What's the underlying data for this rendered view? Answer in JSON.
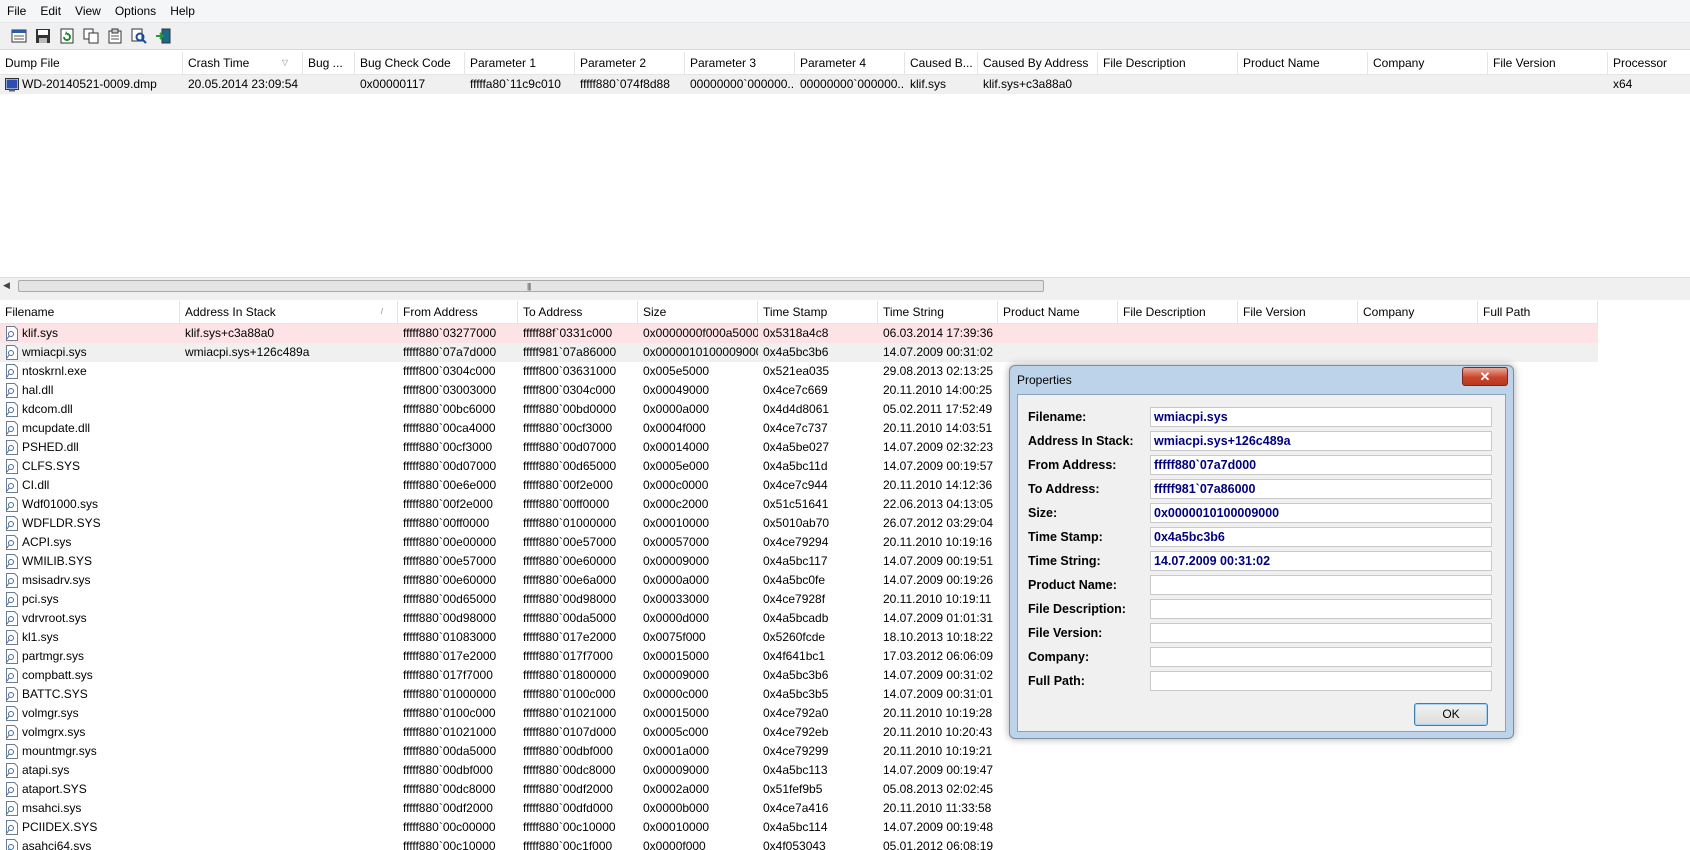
{
  "menu": [
    "File",
    "Edit",
    "View",
    "Options",
    "Help"
  ],
  "toolbar": [
    "properties-icon",
    "save-icon",
    "refresh-icon",
    "copy-icon",
    "report-icon",
    "find-icon",
    "exit-icon"
  ],
  "top_table": {
    "columns": [
      "Dump File",
      "Crash Time",
      "Bug ...",
      "Bug Check Code",
      "Parameter 1",
      "Parameter 2",
      "Parameter 3",
      "Parameter 4",
      "Caused B...",
      "Caused By Address",
      "File Description",
      "Product Name",
      "Company",
      "File Version",
      "Processor"
    ],
    "rows": [
      [
        "WD-20140521-0009.dmp",
        "20.05.2014 23:09:54",
        "",
        "0x00000117",
        "fffffa80`11c9c010",
        "fffff880`074f8d88",
        "00000000`000000...",
        "00000000`000000...",
        "klif.sys",
        "klif.sys+c3a88a0",
        "",
        "",
        "",
        "",
        "x64"
      ]
    ]
  },
  "bottom_table": {
    "columns": [
      "Filename",
      "Address In Stack",
      "From Address",
      "To Address",
      "Size",
      "Time Stamp",
      "Time String",
      "Product Name",
      "File Description",
      "File Version",
      "Company",
      "Full Path"
    ],
    "rows": [
      [
        "klif.sys",
        "klif.sys+c3a88a0",
        "fffff880`03277000",
        "fffff88f`0331c000",
        "0x0000000f000a5000",
        "0x5318a4c8",
        "06.03.2014 17:39:36"
      ],
      [
        "wmiacpi.sys",
        "wmiacpi.sys+126c489a",
        "fffff880`07a7d000",
        "fffff981`07a86000",
        "0x0000010100009000",
        "0x4a5bc3b6",
        "14.07.2009 00:31:02"
      ],
      [
        "ntoskrnl.exe",
        "",
        "fffff800`0304c000",
        "fffff800`03631000",
        "0x005e5000",
        "0x521ea035",
        "29.08.2013 02:13:25"
      ],
      [
        "hal.dll",
        "",
        "fffff800`03003000",
        "fffff800`0304c000",
        "0x00049000",
        "0x4ce7c669",
        "20.11.2010 14:00:25"
      ],
      [
        "kdcom.dll",
        "",
        "fffff880`00bc6000",
        "fffff880`00bd0000",
        "0x0000a000",
        "0x4d4d8061",
        "05.02.2011 17:52:49"
      ],
      [
        "mcupdate.dll",
        "",
        "fffff880`00ca4000",
        "fffff880`00cf3000",
        "0x0004f000",
        "0x4ce7c737",
        "20.11.2010 14:03:51"
      ],
      [
        "PSHED.dll",
        "",
        "fffff880`00cf3000",
        "fffff880`00d07000",
        "0x00014000",
        "0x4a5be027",
        "14.07.2009 02:32:23"
      ],
      [
        "CLFS.SYS",
        "",
        "fffff880`00d07000",
        "fffff880`00d65000",
        "0x0005e000",
        "0x4a5bc11d",
        "14.07.2009 00:19:57"
      ],
      [
        "CI.dll",
        "",
        "fffff880`00e6e000",
        "fffff880`00f2e000",
        "0x000c0000",
        "0x4ce7c944",
        "20.11.2010 14:12:36"
      ],
      [
        "Wdf01000.sys",
        "",
        "fffff880`00f2e000",
        "fffff880`00ff0000",
        "0x000c2000",
        "0x51c51641",
        "22.06.2013 04:13:05"
      ],
      [
        "WDFLDR.SYS",
        "",
        "fffff880`00ff0000",
        "fffff880`01000000",
        "0x00010000",
        "0x5010ab70",
        "26.07.2012 03:29:04"
      ],
      [
        "ACPI.sys",
        "",
        "fffff880`00e00000",
        "fffff880`00e57000",
        "0x00057000",
        "0x4ce79294",
        "20.11.2010 10:19:16"
      ],
      [
        "WMILIB.SYS",
        "",
        "fffff880`00e57000",
        "fffff880`00e60000",
        "0x00009000",
        "0x4a5bc117",
        "14.07.2009 00:19:51"
      ],
      [
        "msisadrv.sys",
        "",
        "fffff880`00e60000",
        "fffff880`00e6a000",
        "0x0000a000",
        "0x4a5bc0fe",
        "14.07.2009 00:19:26"
      ],
      [
        "pci.sys",
        "",
        "fffff880`00d65000",
        "fffff880`00d98000",
        "0x00033000",
        "0x4ce7928f",
        "20.11.2010 10:19:11"
      ],
      [
        "vdrvroot.sys",
        "",
        "fffff880`00d98000",
        "fffff880`00da5000",
        "0x0000d000",
        "0x4a5bcadb",
        "14.07.2009 01:01:31"
      ],
      [
        "kl1.sys",
        "",
        "fffff880`01083000",
        "fffff880`017e2000",
        "0x0075f000",
        "0x5260fcde",
        "18.10.2013 10:18:22"
      ],
      [
        "partmgr.sys",
        "",
        "fffff880`017e2000",
        "fffff880`017f7000",
        "0x00015000",
        "0x4f641bc1",
        "17.03.2012 06:06:09"
      ],
      [
        "compbatt.sys",
        "",
        "fffff880`017f7000",
        "fffff880`01800000",
        "0x00009000",
        "0x4a5bc3b6",
        "14.07.2009 00:31:02"
      ],
      [
        "BATTC.SYS",
        "",
        "fffff880`01000000",
        "fffff880`0100c000",
        "0x0000c000",
        "0x4a5bc3b5",
        "14.07.2009 00:31:01"
      ],
      [
        "volmgr.sys",
        "",
        "fffff880`0100c000",
        "fffff880`01021000",
        "0x00015000",
        "0x4ce792a0",
        "20.11.2010 10:19:28"
      ],
      [
        "volmgrx.sys",
        "",
        "fffff880`01021000",
        "fffff880`0107d000",
        "0x0005c000",
        "0x4ce792eb",
        "20.11.2010 10:20:43"
      ],
      [
        "mountmgr.sys",
        "",
        "fffff880`00da5000",
        "fffff880`00dbf000",
        "0x0001a000",
        "0x4ce79299",
        "20.11.2010 10:19:21"
      ],
      [
        "atapi.sys",
        "",
        "fffff880`00dbf000",
        "fffff880`00dc8000",
        "0x00009000",
        "0x4a5bc113",
        "14.07.2009 00:19:47"
      ],
      [
        "ataport.SYS",
        "",
        "fffff880`00dc8000",
        "fffff880`00df2000",
        "0x0002a000",
        "0x51fef9b5",
        "05.08.2013 02:02:45"
      ],
      [
        "msahci.sys",
        "",
        "fffff880`00df2000",
        "fffff880`00dfd000",
        "0x0000b000",
        "0x4ce7a416",
        "20.11.2010 11:33:58"
      ],
      [
        "PCIIDEX.SYS",
        "",
        "fffff880`00c00000",
        "fffff880`00c10000",
        "0x00010000",
        "0x4a5bc114",
        "14.07.2009 00:19:48"
      ],
      [
        "asahci64.sys",
        "",
        "fffff880`00c10000",
        "fffff880`00c1f000",
        "0x0000f000",
        "0x4f053043",
        "05.01.2012 06:08:19"
      ]
    ]
  },
  "dialog": {
    "title": "Properties",
    "close": "✕",
    "fields": [
      {
        "label": "Filename:",
        "value": "wmiacpi.sys"
      },
      {
        "label": "Address In Stack:",
        "value": "wmiacpi.sys+126c489a"
      },
      {
        "label": "From Address:",
        "value": "fffff880`07a7d000"
      },
      {
        "label": "To Address:",
        "value": "fffff981`07a86000"
      },
      {
        "label": "Size:",
        "value": "0x0000010100009000"
      },
      {
        "label": "Time Stamp:",
        "value": "0x4a5bc3b6"
      },
      {
        "label": "Time String:",
        "value": "14.07.2009 00:31:02"
      },
      {
        "label": "Product Name:",
        "value": ""
      },
      {
        "label": "File Description:",
        "value": ""
      },
      {
        "label": "File Version:",
        "value": ""
      },
      {
        "label": "Company:",
        "value": ""
      },
      {
        "label": "Full Path:",
        "value": ""
      }
    ],
    "ok_label": "OK"
  },
  "colors": {
    "highlight_red": "#fde3e5",
    "highlight_gray": "#f0f0f0",
    "value_text": "#000080"
  }
}
